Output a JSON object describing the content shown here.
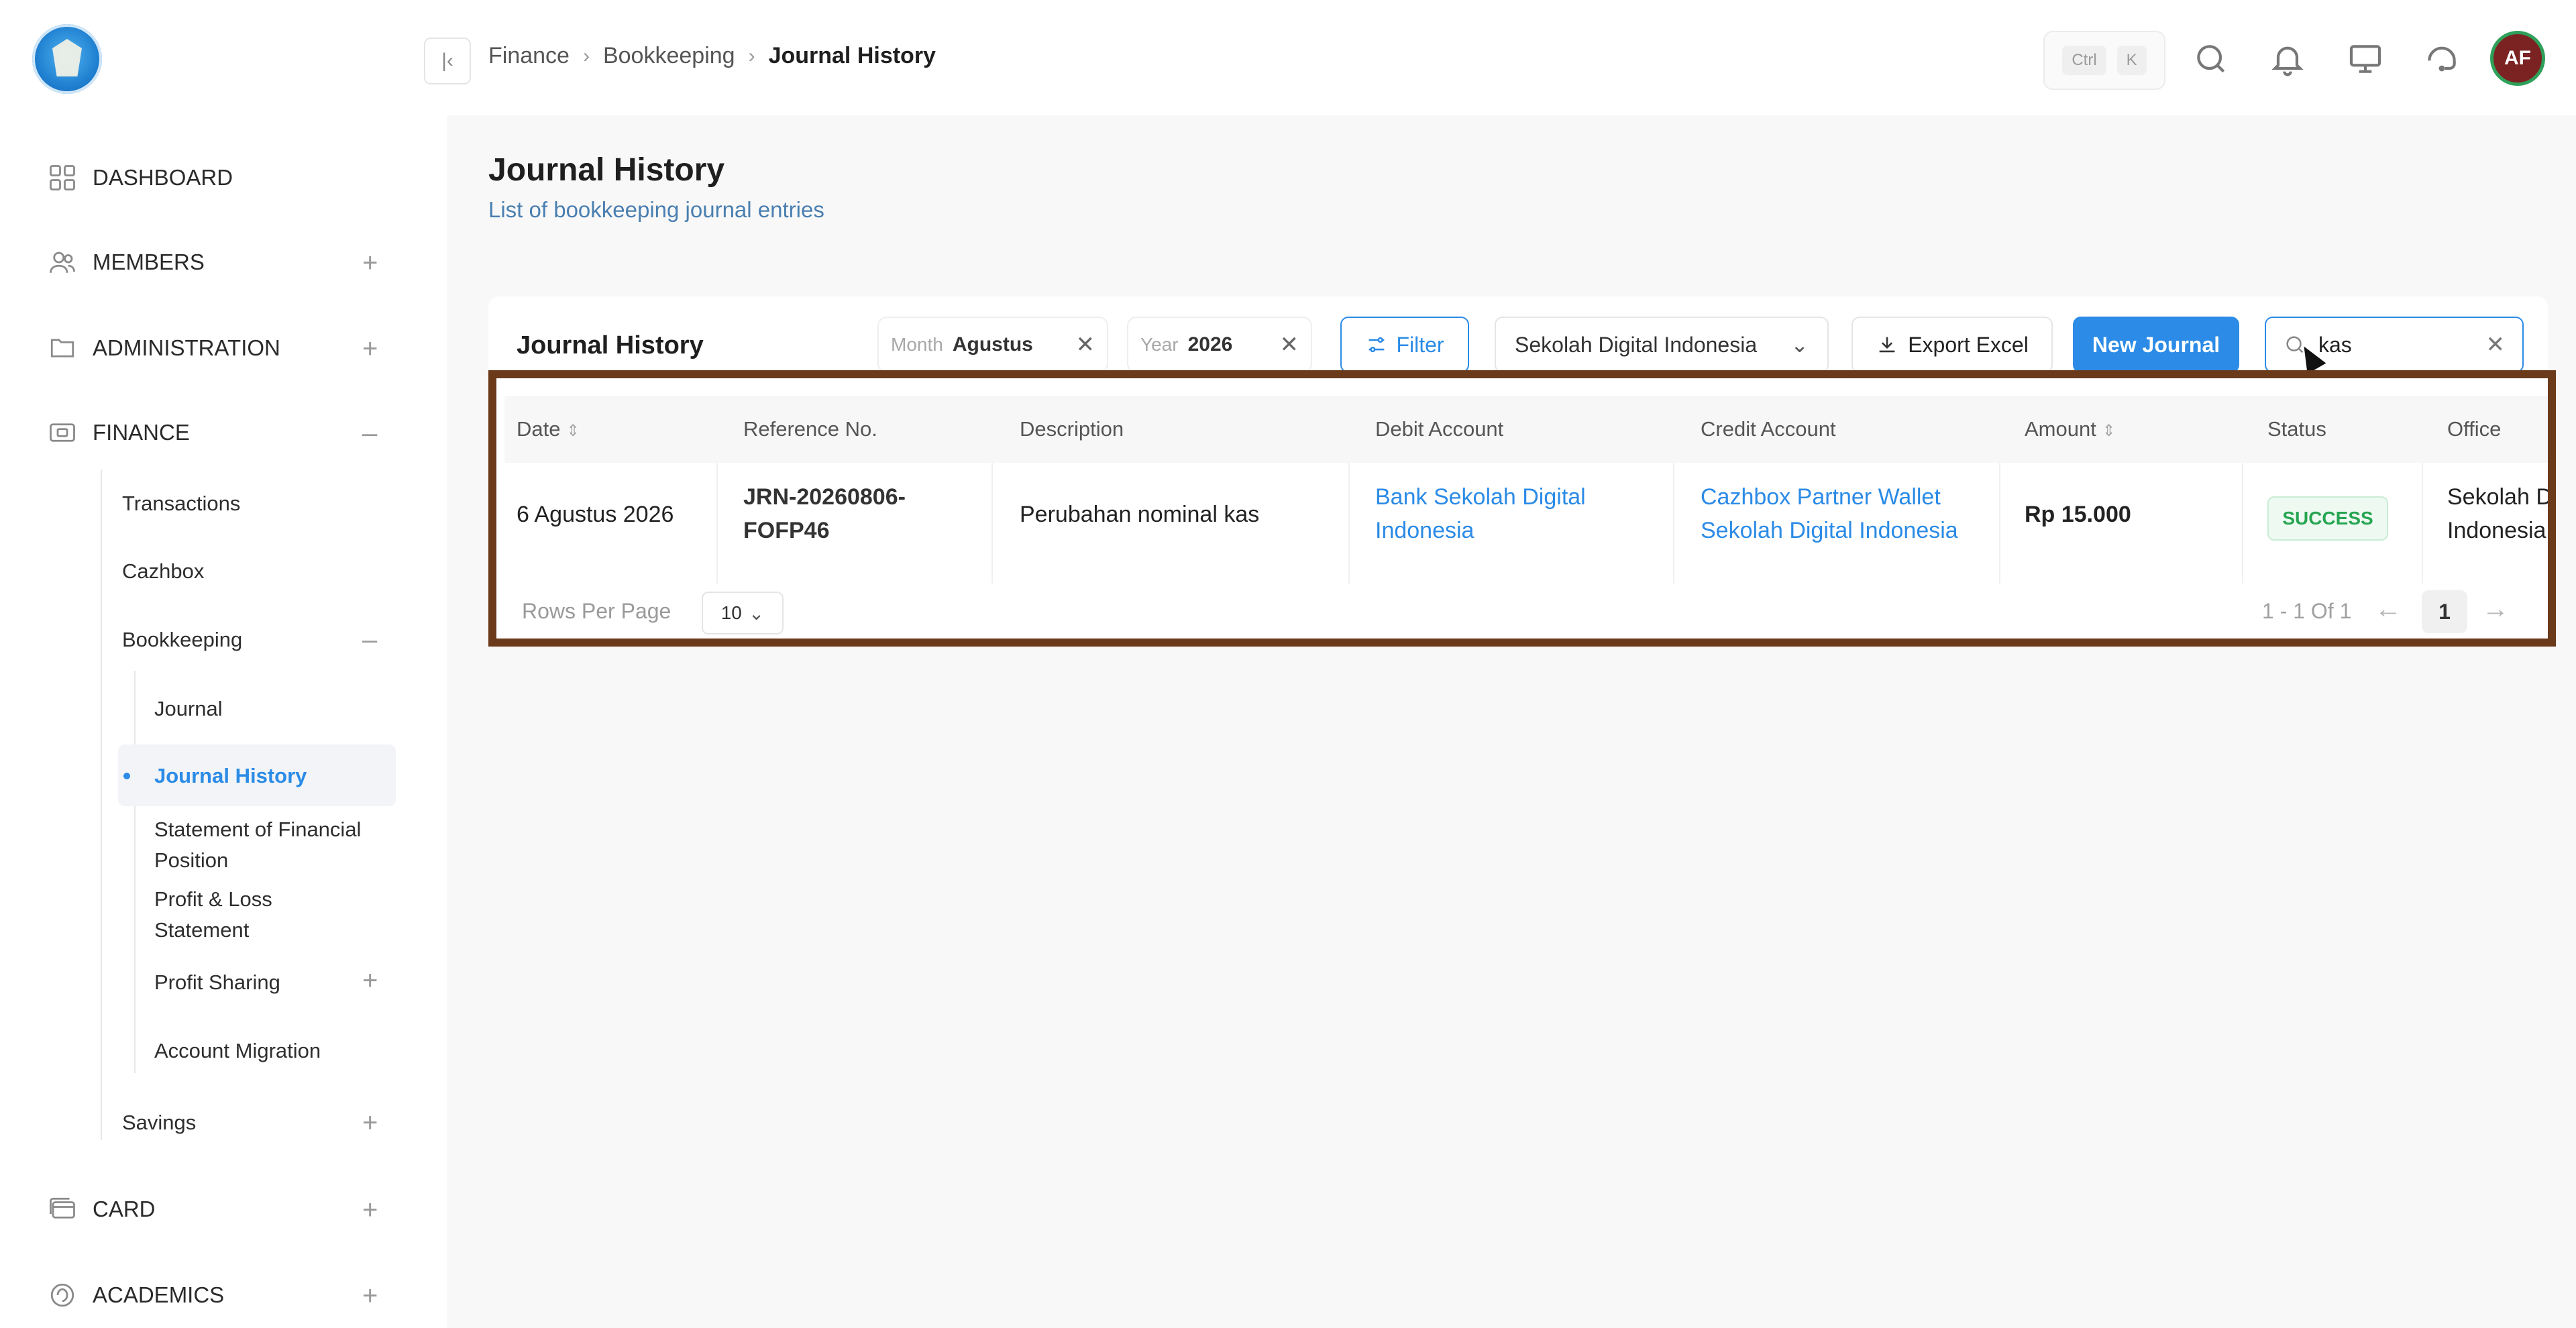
{
  "breadcrumb": {
    "items": [
      "Finance",
      "Bookkeeping"
    ],
    "current": "Journal History"
  },
  "shortcut": {
    "ctrl": "Ctrl",
    "key": "K"
  },
  "user": {
    "initials": "AF"
  },
  "sidebar": {
    "dashboard": "DASHBOARD",
    "members": "MEMBERS",
    "administration": "ADMINISTRATION",
    "finance": "FINANCE",
    "finance_items": {
      "transactions": "Transactions",
      "cazhbox": "Cazhbox",
      "bookkeeping": "Bookkeeping",
      "savings": "Savings"
    },
    "bookkeeping_items": {
      "journal": "Journal",
      "journal_history": "Journal History",
      "sfp_line1": "Statement of Financial",
      "sfp_line2": "Position",
      "pl_line1": "Profit & Loss",
      "pl_line2": "Statement",
      "profit_sharing": "Profit Sharing",
      "account_migration": "Account Migration"
    },
    "card": "CARD",
    "academics": "ACADEMICS"
  },
  "page": {
    "title": "Journal History",
    "subtitle": "List of bookkeeping journal entries"
  },
  "card": {
    "title": "Journal History"
  },
  "filters": {
    "month_label": "Month",
    "month_value": "Agustus",
    "year_label": "Year",
    "year_value": "2026",
    "filter_button": "Filter",
    "office_select": "Sekolah Digital Indonesia",
    "export_button": "Export Excel",
    "new_button": "New Journal",
    "search_value": "kas"
  },
  "table": {
    "columns": [
      "Date",
      "Reference No.",
      "Description",
      "Debit Account",
      "Credit Account",
      "Amount",
      "Status",
      "Office"
    ],
    "rows": [
      {
        "date": "6 Agustus 2026",
        "ref_line1": "JRN-20260806-",
        "ref_line2": "FOFP46",
        "description": "Perubahan nominal kas",
        "debit_line1": "Bank Sekolah Digital",
        "debit_line2": "Indonesia",
        "credit_line1": "Cazhbox Partner Wallet",
        "credit_line2": "Sekolah Digital Indonesia",
        "amount": "Rp 15.000",
        "status": "SUCCESS",
        "office_line1": "Sekolah D",
        "office_line2": "Indonesia"
      }
    ]
  },
  "pagination": {
    "rows_label": "Rows Per Page",
    "rows_value": "10",
    "info": "1 - 1 Of 1",
    "current_page": "1",
    "prev": "←",
    "next": "→"
  },
  "colors": {
    "accent": "#2b8be6",
    "success": "#27a552",
    "highlight_border": "#6b3a1a",
    "avatar_bg": "#7b2222"
  }
}
